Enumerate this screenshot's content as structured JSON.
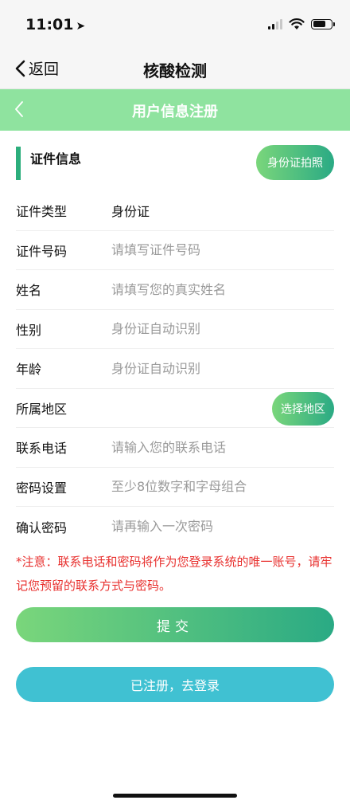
{
  "status": {
    "time": "11:01",
    "location_arrow": "➤"
  },
  "nav": {
    "back_label": "返回",
    "title": "核酸检测"
  },
  "header": {
    "title": "用户信息注册"
  },
  "section": {
    "title": "证件信息",
    "id_photo_button": "身份证拍照"
  },
  "fields": {
    "id_type": {
      "label": "证件类型",
      "value": "身份证"
    },
    "id_number": {
      "label": "证件号码",
      "placeholder": "请填写证件号码"
    },
    "name": {
      "label": "姓名",
      "placeholder": "请填写您的真实姓名"
    },
    "gender": {
      "label": "性别",
      "placeholder": "身份证自动识别"
    },
    "age": {
      "label": "年龄",
      "placeholder": "身份证自动识别"
    },
    "region": {
      "label": "所属地区",
      "button": "选择地区"
    },
    "phone": {
      "label": "联系电话",
      "placeholder": "请输入您的联系电话"
    },
    "password": {
      "label": "密码设置",
      "placeholder": "至少8位数字和字母组合"
    },
    "confirm_password": {
      "label": "确认密码",
      "placeholder": "请再输入一次密码"
    }
  },
  "notice": "*注意：联系电话和密码将作为您登录系统的唯一账号，请牢记您预留的联系方式与密码。",
  "actions": {
    "submit": "提交",
    "login": "已注册，去登录"
  },
  "colors": {
    "header_green": "#8fe39f",
    "accent_green": "#2cae7c",
    "login_blue": "#40c1d2",
    "notice_red": "#e8312f"
  },
  "icons": {
    "nav_back": "chevron-left-icon",
    "header_back": "chevron-left-icon",
    "wifi": "wifi-icon",
    "battery": "battery-icon",
    "signal": "signal-icon"
  }
}
